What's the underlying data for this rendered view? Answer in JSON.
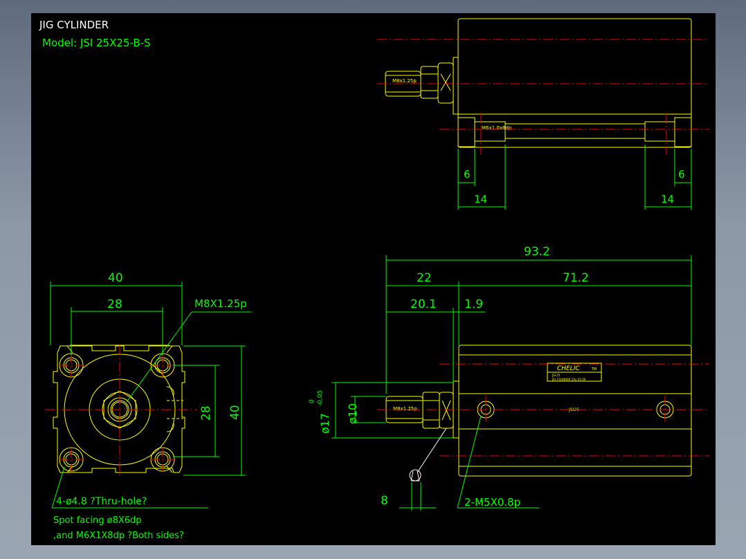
{
  "title": "JIG CYLINDER",
  "model": "Model: JSI 25X25-B-S",
  "colors": {
    "background": "#000000",
    "outline": "#ffff00",
    "dimension": "#00ff00",
    "centerline": "#ff0000",
    "title": "#ffffff"
  },
  "top_view": {
    "thread_label": "M8x1.25p",
    "tap_label": "M6x1.0x8dp",
    "dims": {
      "left_6": "6",
      "right_6": "6",
      "left_14": "14",
      "right_14": "14"
    }
  },
  "front_view": {
    "dims": {
      "width": "40",
      "pitch_h": "28",
      "pitch_v": "28",
      "height": "40"
    },
    "callout_thread": "M8X1.25p",
    "callout_holes": "4-ø4.8 ?Thru-hole?",
    "note_line1": "Spot facing  ø8X6dp",
    "note_line2": ",and M6X1X8dp ?Both sides?"
  },
  "side_view": {
    "dims": {
      "overall": "93.2",
      "rod": "22",
      "body": "71.2",
      "rod_ext": "20.1",
      "flange": "1.9",
      "wrench": "8",
      "rod_dia": "ø10",
      "boss_dia": "ø17",
      "boss_tol_upper": "0",
      "boss_tol_lower": "-0.05"
    },
    "thread_label": "M8x1.25p",
    "brand": "CHELIC",
    "brand_suffix": "TM",
    "plate_line1": "JSI 25",
    "plate_line2": "JIG CYLINDER  25x  25-30",
    "body_label": "JSI25",
    "callout_ports": "2-M5X0.8p"
  }
}
